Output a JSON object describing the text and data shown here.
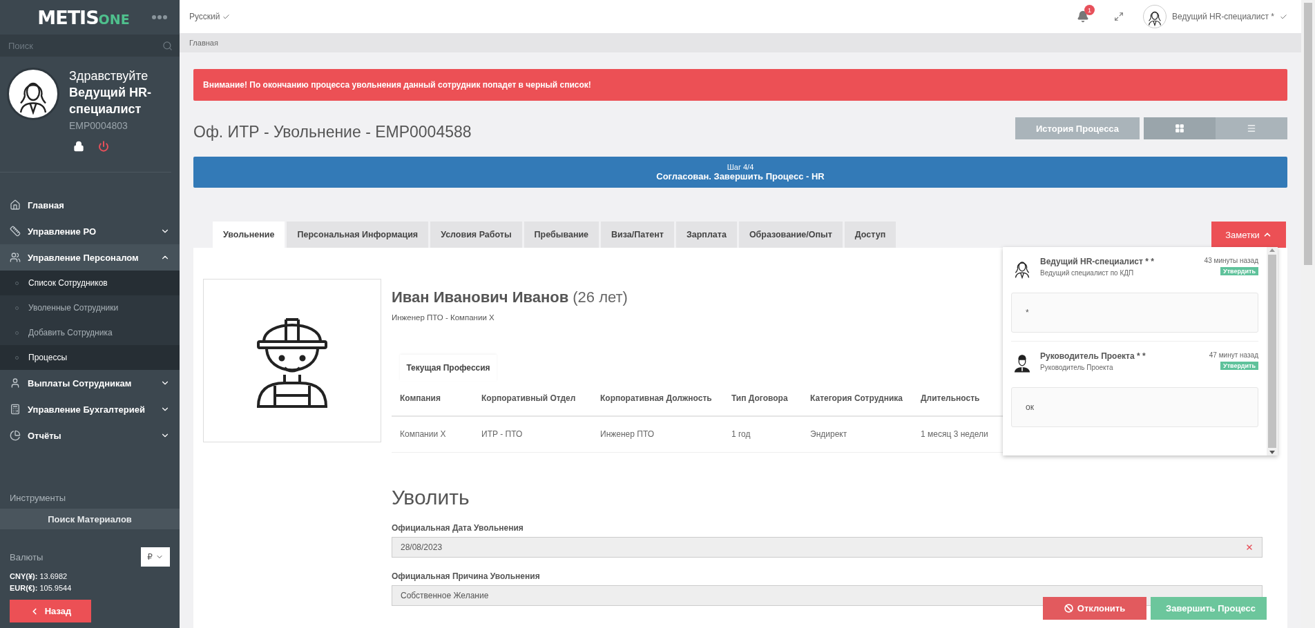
{
  "sidebar": {
    "logo": {
      "text": "METIS",
      "accent": "ONE"
    },
    "search": {
      "placeholder": "Поиск"
    },
    "profile": {
      "greeting": "Здравствуйте",
      "name": "Ведущий HR-специалист",
      "id": "EMP0004803"
    },
    "menu": [
      {
        "label": "Главная"
      },
      {
        "label": "Управление РО",
        "expanded": false
      },
      {
        "label": "Управление Персоналом",
        "expanded": true,
        "children": [
          {
            "label": "Список Сотрудников",
            "selected": true
          },
          {
            "label": "Уволенные Сотрудники",
            "selected": false
          },
          {
            "label": "Добавить Сотрудника",
            "selected": false
          },
          {
            "label": "Процессы",
            "selected": true
          }
        ]
      },
      {
        "label": "Выплаты Сотрудникам",
        "expanded": false
      },
      {
        "label": "Управление Бухгалтерией",
        "expanded": false
      },
      {
        "label": "Отчёты",
        "expanded": false
      }
    ],
    "tools": {
      "title": "Инструменты",
      "button": "Поиск Материалов"
    },
    "currencies": {
      "title": "Валюты",
      "selector": "₽",
      "rates": [
        {
          "code": "CNY(¥):",
          "value": "13.6982"
        },
        {
          "code": "EUR(€):",
          "value": "105.9544"
        }
      ]
    },
    "back_button": "Назад"
  },
  "topbar": {
    "language": "Русский",
    "notifications": "1",
    "user": "Ведущий HR-специалист *"
  },
  "breadcrumb": "Главная",
  "alert": "Внимание! По окончанию процесса увольнения данный сотрудник попадет в черный список!",
  "title": "Оф. ИТР - Увольнение - EMP0004588",
  "history_button": "История Процесса",
  "view_toggle": [
    {
      "kind": "grid",
      "selected": true
    },
    {
      "kind": "list",
      "selected": false
    }
  ],
  "step": {
    "label": "Шаг 4/4",
    "title": "Согласован. Завершить Процесс - HR"
  },
  "tabs": [
    {
      "label": "Увольнение",
      "selected": true
    },
    {
      "label": "Персональная Информация",
      "selected": false
    },
    {
      "label": "Условия Работы",
      "selected": false
    },
    {
      "label": "Пребывание",
      "selected": false
    },
    {
      "label": "Виза/Патент",
      "selected": false
    },
    {
      "label": "Зарплата",
      "selected": false
    },
    {
      "label": "Образование/Опыт",
      "selected": false
    },
    {
      "label": "Доступ",
      "selected": false
    }
  ],
  "notes": {
    "button": "Заметки",
    "expanded": true,
    "items": [
      {
        "kind": "female",
        "author": "Ведущий HR-специалист * *",
        "role": "Ведущий специалист по КДП",
        "time": "43 минуты назад",
        "badge": "Утвердить",
        "text": "*"
      },
      {
        "kind": "male",
        "author": "Руководитель Проекта * *",
        "role": "Руководитель Проекта",
        "time": "47 минут назад",
        "badge": "Утвердить",
        "text": "ок"
      }
    ]
  },
  "employee": {
    "name": "Иван Иванович Иванов",
    "age": "(26 лет)",
    "position": "Инженер ПТО - Компании X"
  },
  "profession": {
    "tab": "Текущая Профессия",
    "columns": [
      "Компания",
      "Корпоративный Отдел",
      "Корпоративная Должность",
      "Тип Договора",
      "Категория Сотрудника",
      "Длительность"
    ],
    "rows": [
      [
        "Компании X",
        "ИТР - ПТО",
        "Инженер ПТО",
        "1 год",
        "Эндирект",
        "1 месяц 3 недели"
      ]
    ]
  },
  "dismissal": {
    "title": "Уволить",
    "fields": [
      {
        "kind": "date",
        "label": "Официальная Дата Увольнения",
        "value": "28/08/2023"
      },
      {
        "kind": "select",
        "label": "Официальная Причина Увольнения",
        "value": "Собственное Желание"
      }
    ]
  },
  "actions": [
    {
      "kind": "reject",
      "label": "Отклонить"
    },
    {
      "kind": "complete",
      "label": "Завершить Процесс"
    }
  ]
}
